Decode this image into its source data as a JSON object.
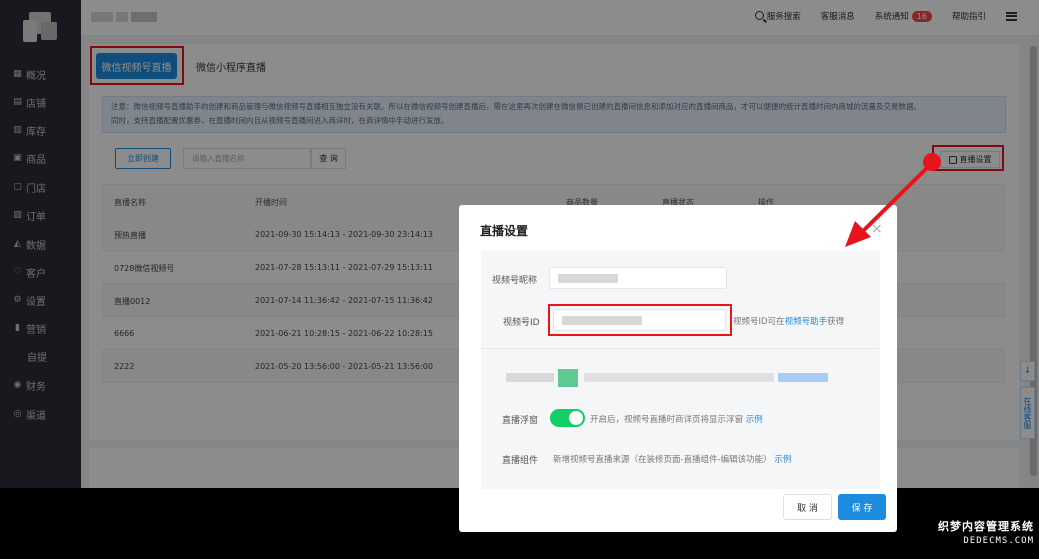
{
  "sidebar": {
    "items": [
      {
        "label": "概况",
        "icon": "store-icon"
      },
      {
        "label": "店铺",
        "icon": "shop-icon"
      },
      {
        "label": "库存",
        "icon": "inventory-icon"
      },
      {
        "label": "商品",
        "icon": "goods-icon"
      },
      {
        "label": "门店",
        "icon": "store-front-icon"
      },
      {
        "label": "订单",
        "icon": "order-icon"
      },
      {
        "label": "数据",
        "icon": "chart-icon"
      },
      {
        "label": "客户",
        "icon": "heart-icon"
      },
      {
        "label": "设置",
        "icon": "gear-icon"
      },
      {
        "label": "营销",
        "icon": "bar-icon"
      },
      {
        "label": "自提",
        "icon": ""
      },
      {
        "label": "财务",
        "icon": "finance-icon"
      },
      {
        "label": "渠道",
        "icon": "channel-icon"
      }
    ]
  },
  "topbar": {
    "service_search": "服务搜索",
    "customer_msg": "客服消息",
    "system_notice": "系统通知",
    "notice_count": "16",
    "help": "帮助指引"
  },
  "tabs": {
    "active": "微信视频号直播",
    "other": "微信小程序直播"
  },
  "notice": {
    "line1": "注意：微信视频号直播助手的创建和商品管理与微信视频号直播相互独立没有关联。所以在微信视频号创建直播后，需在这里再次创建在微信侧已创建的直播间信息和添加对应的直播间商品，才可以便捷的统计直播时间内商城的流量及交易数据。",
    "line2": "同时，支持直播配置优惠券，在直播时间内且从视频号直播间进入商详时，在商详情中手动进行发放。"
  },
  "toolbar": {
    "create_label": "立即创建",
    "search_placeholder": "请输入直播名称",
    "query_label": "查 询",
    "settings_label": "直播设置"
  },
  "table": {
    "headers": [
      "直播名称",
      "开播时间",
      "商品数量",
      "直播状态",
      "操作"
    ],
    "rows": [
      {
        "name": "预热直播",
        "time": "2021-09-30 15:14:13 - 2021-09-30 23:14:13"
      },
      {
        "name": "0728微信视频号",
        "time": "2021-07-28 15:13:11 - 2021-07-29 15:13:11"
      },
      {
        "name": "直播0012",
        "time": "2021-07-14 11:36:42 - 2021-07-15 11:36:42"
      },
      {
        "name": "6666",
        "time": "2021-06-21 10:28:15 - 2021-06-22 10:28:15"
      },
      {
        "name": "2222",
        "time": "2021-05-20 13:56:00 - 2021-05-21 13:56:00"
      }
    ]
  },
  "modal": {
    "title": "直播设置",
    "close": "×",
    "nickname_label": "视频号昵称",
    "id_label": "视频号ID",
    "id_hint_prefix": "视频号ID可在",
    "id_hint_link": "视频号助手",
    "id_hint_suffix": "获得",
    "float_label": "直播浮窗",
    "float_hint": "开启后，视频号直播时商详页将显示浮窗",
    "float_example": "示例",
    "component_label": "直播组件",
    "component_hint": "新增视频号直播来源（在装修页面-直播组件-编辑该功能）",
    "component_example": "示例",
    "cancel_label": "取 消",
    "save_label": "保 存",
    "float_enabled": true
  },
  "float_panel": {
    "download": "↓",
    "chat": "在线客服"
  },
  "watermark": {
    "line1": "织梦内容管理系统",
    "line2": "DEDECMS.COM"
  },
  "colors": {
    "accent": "#1d8ce0",
    "highlight": "#e8141c",
    "toggle_on": "#13ce66",
    "sidebar_bg": "#2b2f3a"
  }
}
